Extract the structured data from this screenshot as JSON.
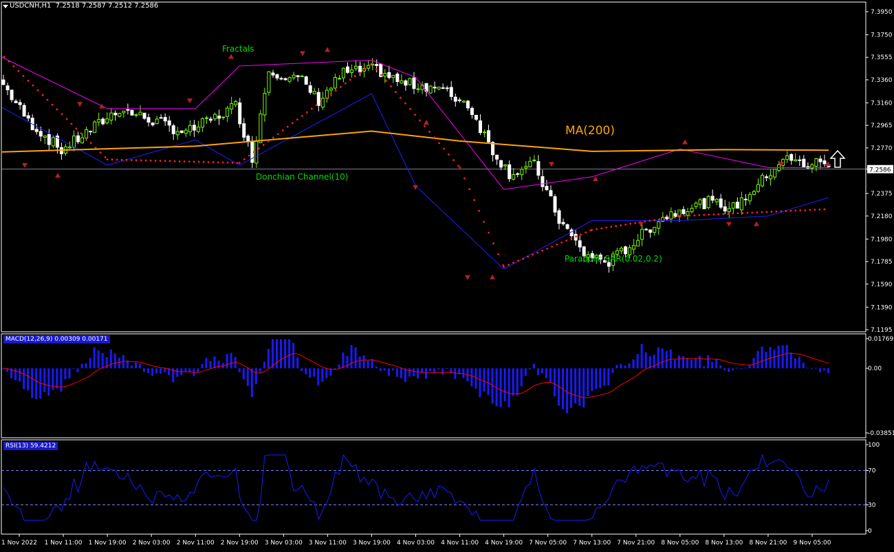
{
  "header": {
    "symbol": "USDCNH,H1",
    "ohlc": "7.2518 7.2587 7.2512 7.2586"
  },
  "annotations": {
    "fractals": "Fractals",
    "ma200": "MA(200)",
    "donchian": "Donchian Channel(10)",
    "sar": "Parabolic SAR(0.02,0.2)"
  },
  "price_axis": {
    "ticks": [
      "7.3950",
      "7.3750",
      "7.3555",
      "7.3360",
      "7.3160",
      "7.2965",
      "7.2770",
      "7.2586",
      "7.2375",
      "7.2180",
      "7.1980",
      "7.1785",
      "7.1590",
      "7.1390",
      "7.1195"
    ],
    "current_price": "7.2586"
  },
  "macd": {
    "label": "MACD(12,26,9) 0.00309 0.00171",
    "ticks": [
      "0.01769",
      "0.00",
      "-0.03851"
    ]
  },
  "rsi": {
    "label": "RSI(13) 59.4212",
    "ticks": [
      "100",
      "70",
      "30",
      "0"
    ]
  },
  "time_axis": [
    "1 Nov 2022",
    "1 Nov 11:00",
    "1 Nov 19:00",
    "2 Nov 03:00",
    "2 Nov 11:00",
    "2 Nov 19:00",
    "3 Nov 03:00",
    "3 Nov 11:00",
    "3 Nov 19:00",
    "4 Nov 03:00",
    "4 Nov 11:00",
    "4 Nov 19:00",
    "7 Nov 05:00",
    "7 Nov 13:00",
    "7 Nov 21:00",
    "8 Nov 05:00",
    "8 Nov 13:00",
    "8 Nov 21:00",
    "9 Nov 05:00"
  ],
  "colors": {
    "bull": "#7cfc00",
    "bear": "#ffffff",
    "ma": "#ffa500",
    "donchian_upper": "#ff00ff",
    "donchian_lower": "#2020ff",
    "sar": "#ff2020",
    "fractal": "#b22222",
    "macd_hist": "#1a1aff",
    "macd_signal": "#ff0000",
    "rsi": "#1a1aff",
    "rsi_levels": "#8080ff",
    "annotation_green": "#00dd00",
    "annotation_orange": "#ffa500"
  },
  "chart_data": [
    {
      "type": "candlestick",
      "symbol": "USDCNH",
      "timeframe": "H1",
      "ylim": [
        7.1195,
        7.395
      ],
      "series": [
        {
          "name": "MA(200)",
          "x": [
            "1 Nov 2022",
            "2 Nov 11:00",
            "3 Nov 19:00",
            "4 Nov 11:00",
            "7 Nov 13:00",
            "8 Nov 13:00",
            "9 Nov 05:00"
          ],
          "values": [
            7.2735,
            7.2785,
            7.2915,
            7.283,
            7.274,
            7.2755,
            7.275
          ]
        },
        {
          "name": "Donchian Channel(10) upper",
          "x": [
            "1 Nov 2022",
            "1 Nov 19:00",
            "2 Nov 11:00",
            "2 Nov 19:00",
            "3 Nov 19:00",
            "4 Nov 03:00",
            "4 Nov 19:00",
            "7 Nov 13:00",
            "8 Nov 05:00",
            "8 Nov 21:00",
            "9 Nov 05:00"
          ],
          "values": [
            7.3555,
            7.311,
            7.311,
            7.348,
            7.353,
            7.338,
            7.241,
            7.252,
            7.276,
            7.26,
            7.26
          ]
        },
        {
          "name": "Donchian Channel(10) lower",
          "x": [
            "1 Nov 2022",
            "1 Nov 19:00",
            "2 Nov 11:00",
            "2 Nov 19:00",
            "3 Nov 19:00",
            "4 Nov 03:00",
            "4 Nov 19:00",
            "7 Nov 13:00",
            "8 Nov 05:00",
            "8 Nov 21:00",
            "9 Nov 05:00"
          ],
          "values": [
            7.312,
            7.262,
            7.284,
            7.262,
            7.324,
            7.244,
            7.172,
            7.214,
            7.214,
            7.218,
            7.234
          ]
        },
        {
          "name": "Parabolic SAR(0.02,0.2)",
          "x": [
            "1 Nov 2022",
            "1 Nov 19:00",
            "2 Nov 19:00",
            "3 Nov 19:00",
            "4 Nov 11:00",
            "4 Nov 19:00",
            "7 Nov 13:00",
            "8 Nov 05:00",
            "9 Nov 05:00"
          ],
          "values": [
            7.356,
            7.267,
            7.264,
            7.35,
            7.26,
            7.174,
            7.206,
            7.218,
            7.224
          ]
        }
      ],
      "last_close": 7.2586
    },
    {
      "type": "bar",
      "name": "MACD(12,26,9)",
      "main": 0.00309,
      "signal": 0.00171,
      "ylim": [
        -0.03851,
        0.01769
      ]
    },
    {
      "type": "line",
      "name": "RSI(13)",
      "last": 59.4212,
      "levels": [
        30,
        70
      ],
      "ylim": [
        0,
        100
      ]
    }
  ]
}
